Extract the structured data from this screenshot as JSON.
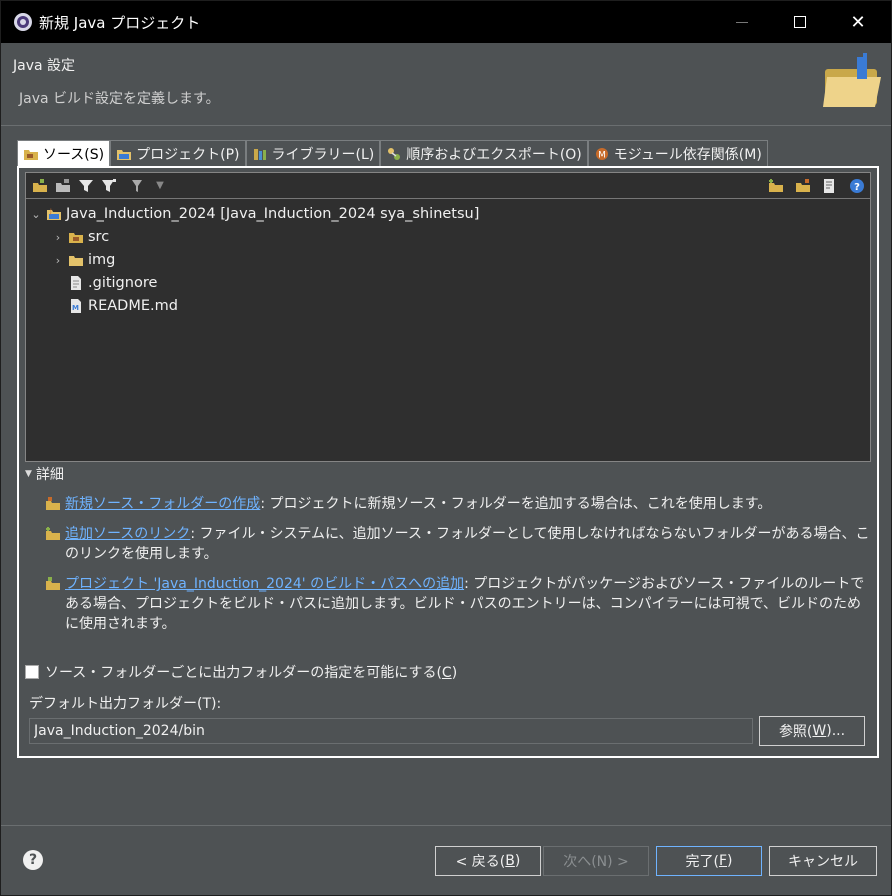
{
  "window": {
    "title": "新規 Java プロジェクト",
    "minimize_icon": "minimize-icon",
    "maximize_icon": "maximize-icon",
    "close_icon": "close-icon",
    "close_glyph": "✕"
  },
  "banner": {
    "title": "Java 設定",
    "description": "Java ビルド設定を定義します。"
  },
  "tabs": [
    {
      "label": "ソース(S)",
      "icon": "source-folder-icon",
      "active": true
    },
    {
      "label": "プロジェクト(P)",
      "icon": "project-folder-icon",
      "active": false
    },
    {
      "label": "ライブラリー(L)",
      "icon": "library-icon",
      "active": false
    },
    {
      "label": "順序およびエクスポート(O)",
      "icon": "order-export-icon",
      "active": false
    },
    {
      "label": "モジュール依存関係(M)",
      "icon": "module-icon",
      "active": false
    }
  ],
  "tree": {
    "root": "Java_Induction_2024 [Java_Induction_2024 sya_shinetsu]",
    "children": [
      {
        "label": "src",
        "icon": "package-folder-icon",
        "expandable": true
      },
      {
        "label": "img",
        "icon": "folder-icon",
        "expandable": true
      },
      {
        "label": ".gitignore",
        "icon": "file-icon",
        "expandable": false
      },
      {
        "label": "README.md",
        "icon": "markdown-file-icon",
        "expandable": false
      }
    ]
  },
  "details": {
    "header": "詳細",
    "items": [
      {
        "link": "新規ソース・フォルダーの作成",
        "text": ": プロジェクトに新規ソース・フォルダーを追加する場合は、これを使用します。"
      },
      {
        "link": "追加ソースのリンク",
        "text": ": ファイル・システムに、追加ソース・フォルダーとして使用しなければならないフォルダーがある場合、このリンクを使用します。"
      },
      {
        "link": "プロジェクト 'Java_Induction_2024' のビルド・パスへの追加",
        "text": ": プロジェクトがパッケージおよびソース・ファイルのルートである場合、プロジェクトをビルド・パスに追加します。ビルド・パスのエントリーは、コンパイラーには可視で、ビルドのために使用されます。"
      }
    ]
  },
  "options": {
    "checkbox_label": "ソース・フォルダーごとに出力フォルダーの指定を可能にする(",
    "checkbox_mnemonic": "C",
    "checkbox_close": ")",
    "checked": false,
    "default_output_label": "デフォルト出力フォルダー(T):",
    "default_output_value": "Java_Induction_2024/bin",
    "browse_label_pre": "参照(",
    "browse_mnemonic": "W",
    "browse_label_post": ")..."
  },
  "footer": {
    "help_glyph": "?",
    "back_pre": "< 戻る(",
    "back_mn": "B",
    "back_post": ")",
    "next": "次へ(N) >",
    "finish_pre": "完了(",
    "finish_mn": "F",
    "finish_post": ")",
    "cancel": "キャンセル"
  },
  "colors": {
    "background": "#4e5254",
    "titlebar": "#000000",
    "tree_bg": "#2f2f2f",
    "link": "#6fb3ff"
  }
}
